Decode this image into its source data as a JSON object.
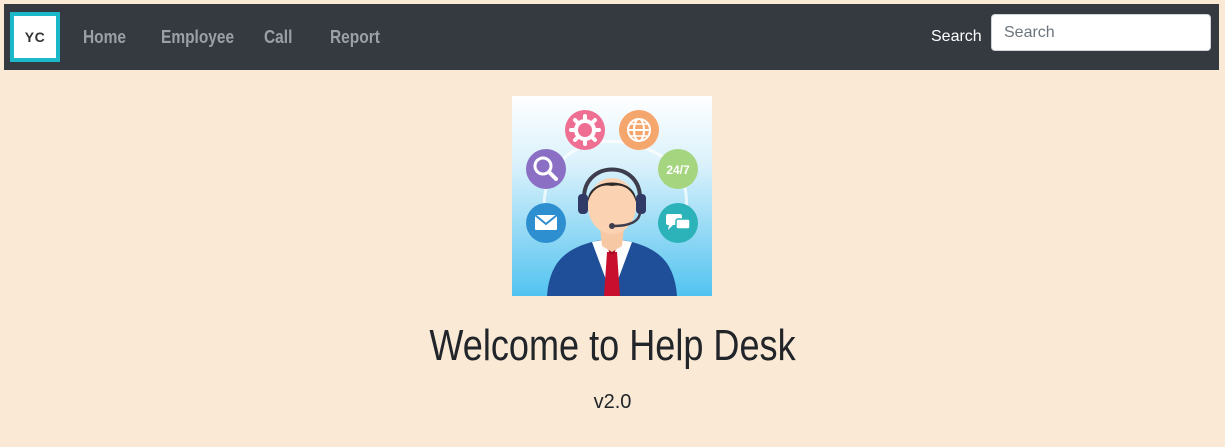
{
  "navbar": {
    "brand": "YC",
    "links": [
      {
        "label": "Home"
      },
      {
        "label": "Employee"
      },
      {
        "label": "Call"
      },
      {
        "label": "Report"
      }
    ],
    "search_label": "Search",
    "search_placeholder": "Search",
    "search_value": ""
  },
  "hero": {
    "image_badge": "24/7",
    "title": "Welcome to Help Desk",
    "version": "v2.0"
  },
  "colors": {
    "page_background": "#f9e9d5",
    "navbar_background": "#343a40",
    "brand_border": "#1ab8c8",
    "nav_link": "#9aa0a6"
  }
}
